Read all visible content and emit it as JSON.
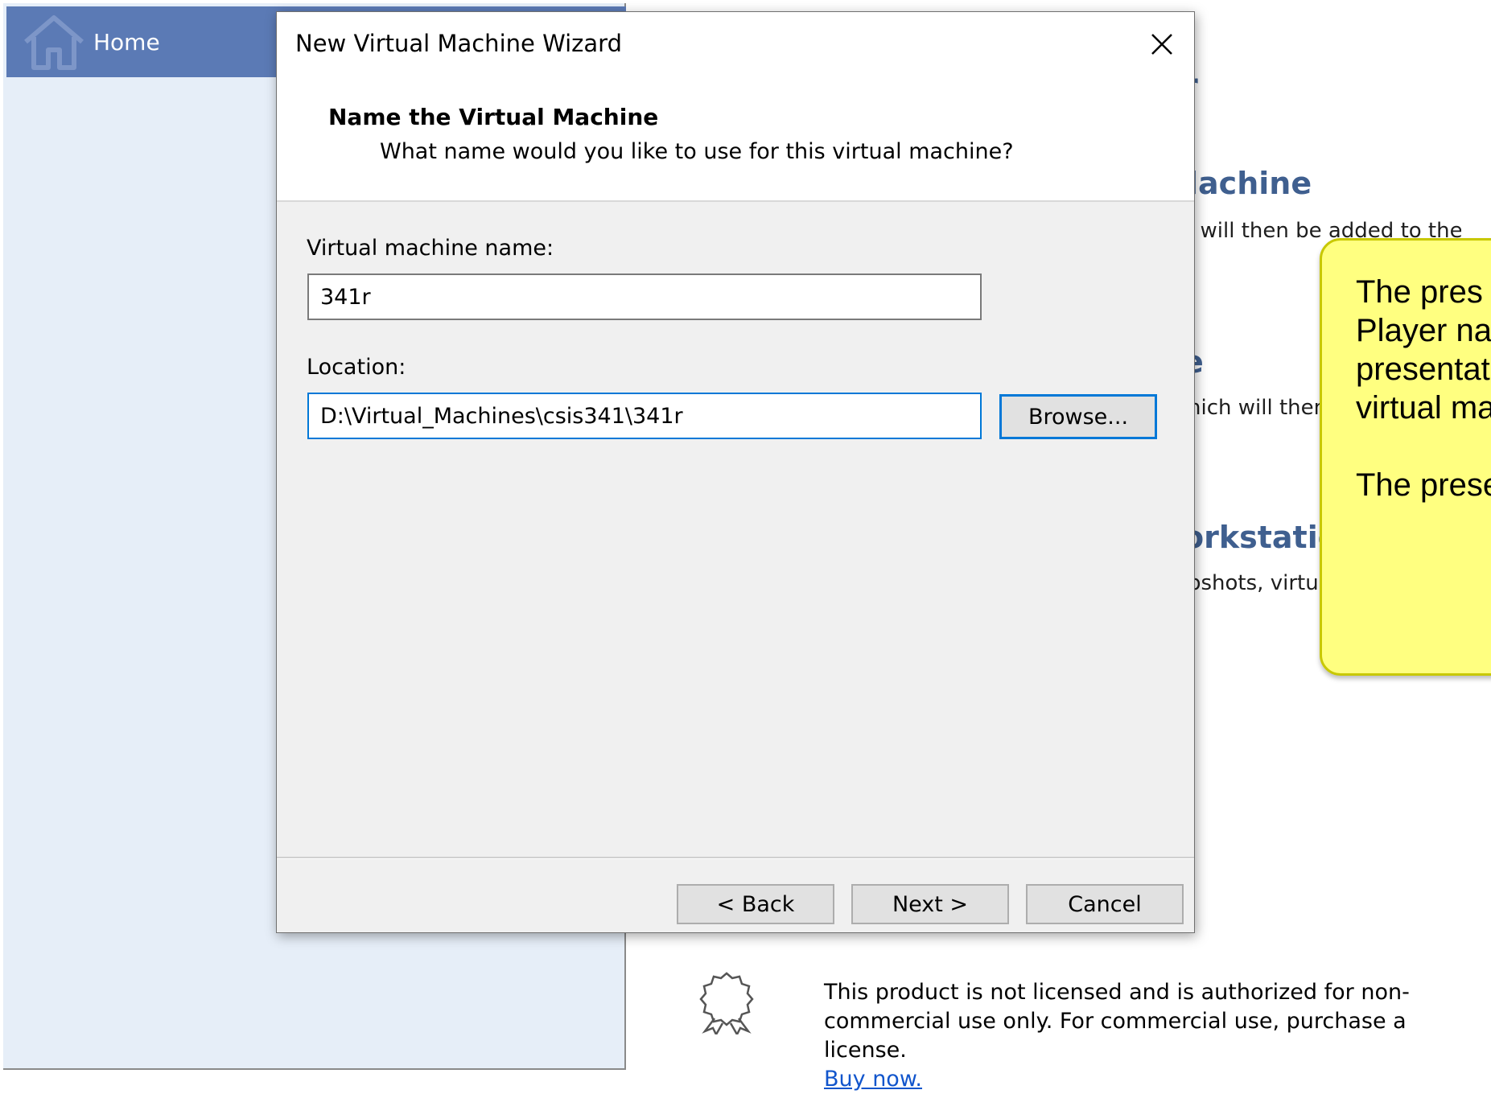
{
  "background": {
    "home_label": "Home",
    "fragments": {
      "heading1": "r",
      "heading2": "lachine",
      "text2": "i will then be added to the",
      "heading3": "e",
      "text3": "hich will then",
      "heading4": "orkstatio",
      "text4": "pshots, virtu"
    },
    "note": {
      "line1": "The pres",
      "line2": "Player na",
      "line3": "presentat",
      "line4": "virtual ma",
      "line5": "The prese"
    },
    "license": {
      "text": "This product is not licensed and is authorized for non-commercial use only. For commercial use, purchase a license.",
      "link": "Buy now."
    }
  },
  "dialog": {
    "title": "New Virtual Machine Wizard",
    "header_title": "Name the Virtual Machine",
    "header_subtitle": "What name would you like to use for this virtual machine?",
    "vm_name_label": "Virtual machine name:",
    "vm_name_value": "341r",
    "location_label": "Location:",
    "location_value": "D:\\Virtual_Machines\\csis341\\341r",
    "browse_label": "Browse...",
    "back_label": "< Back",
    "next_label": "Next >",
    "cancel_label": "Cancel"
  }
}
